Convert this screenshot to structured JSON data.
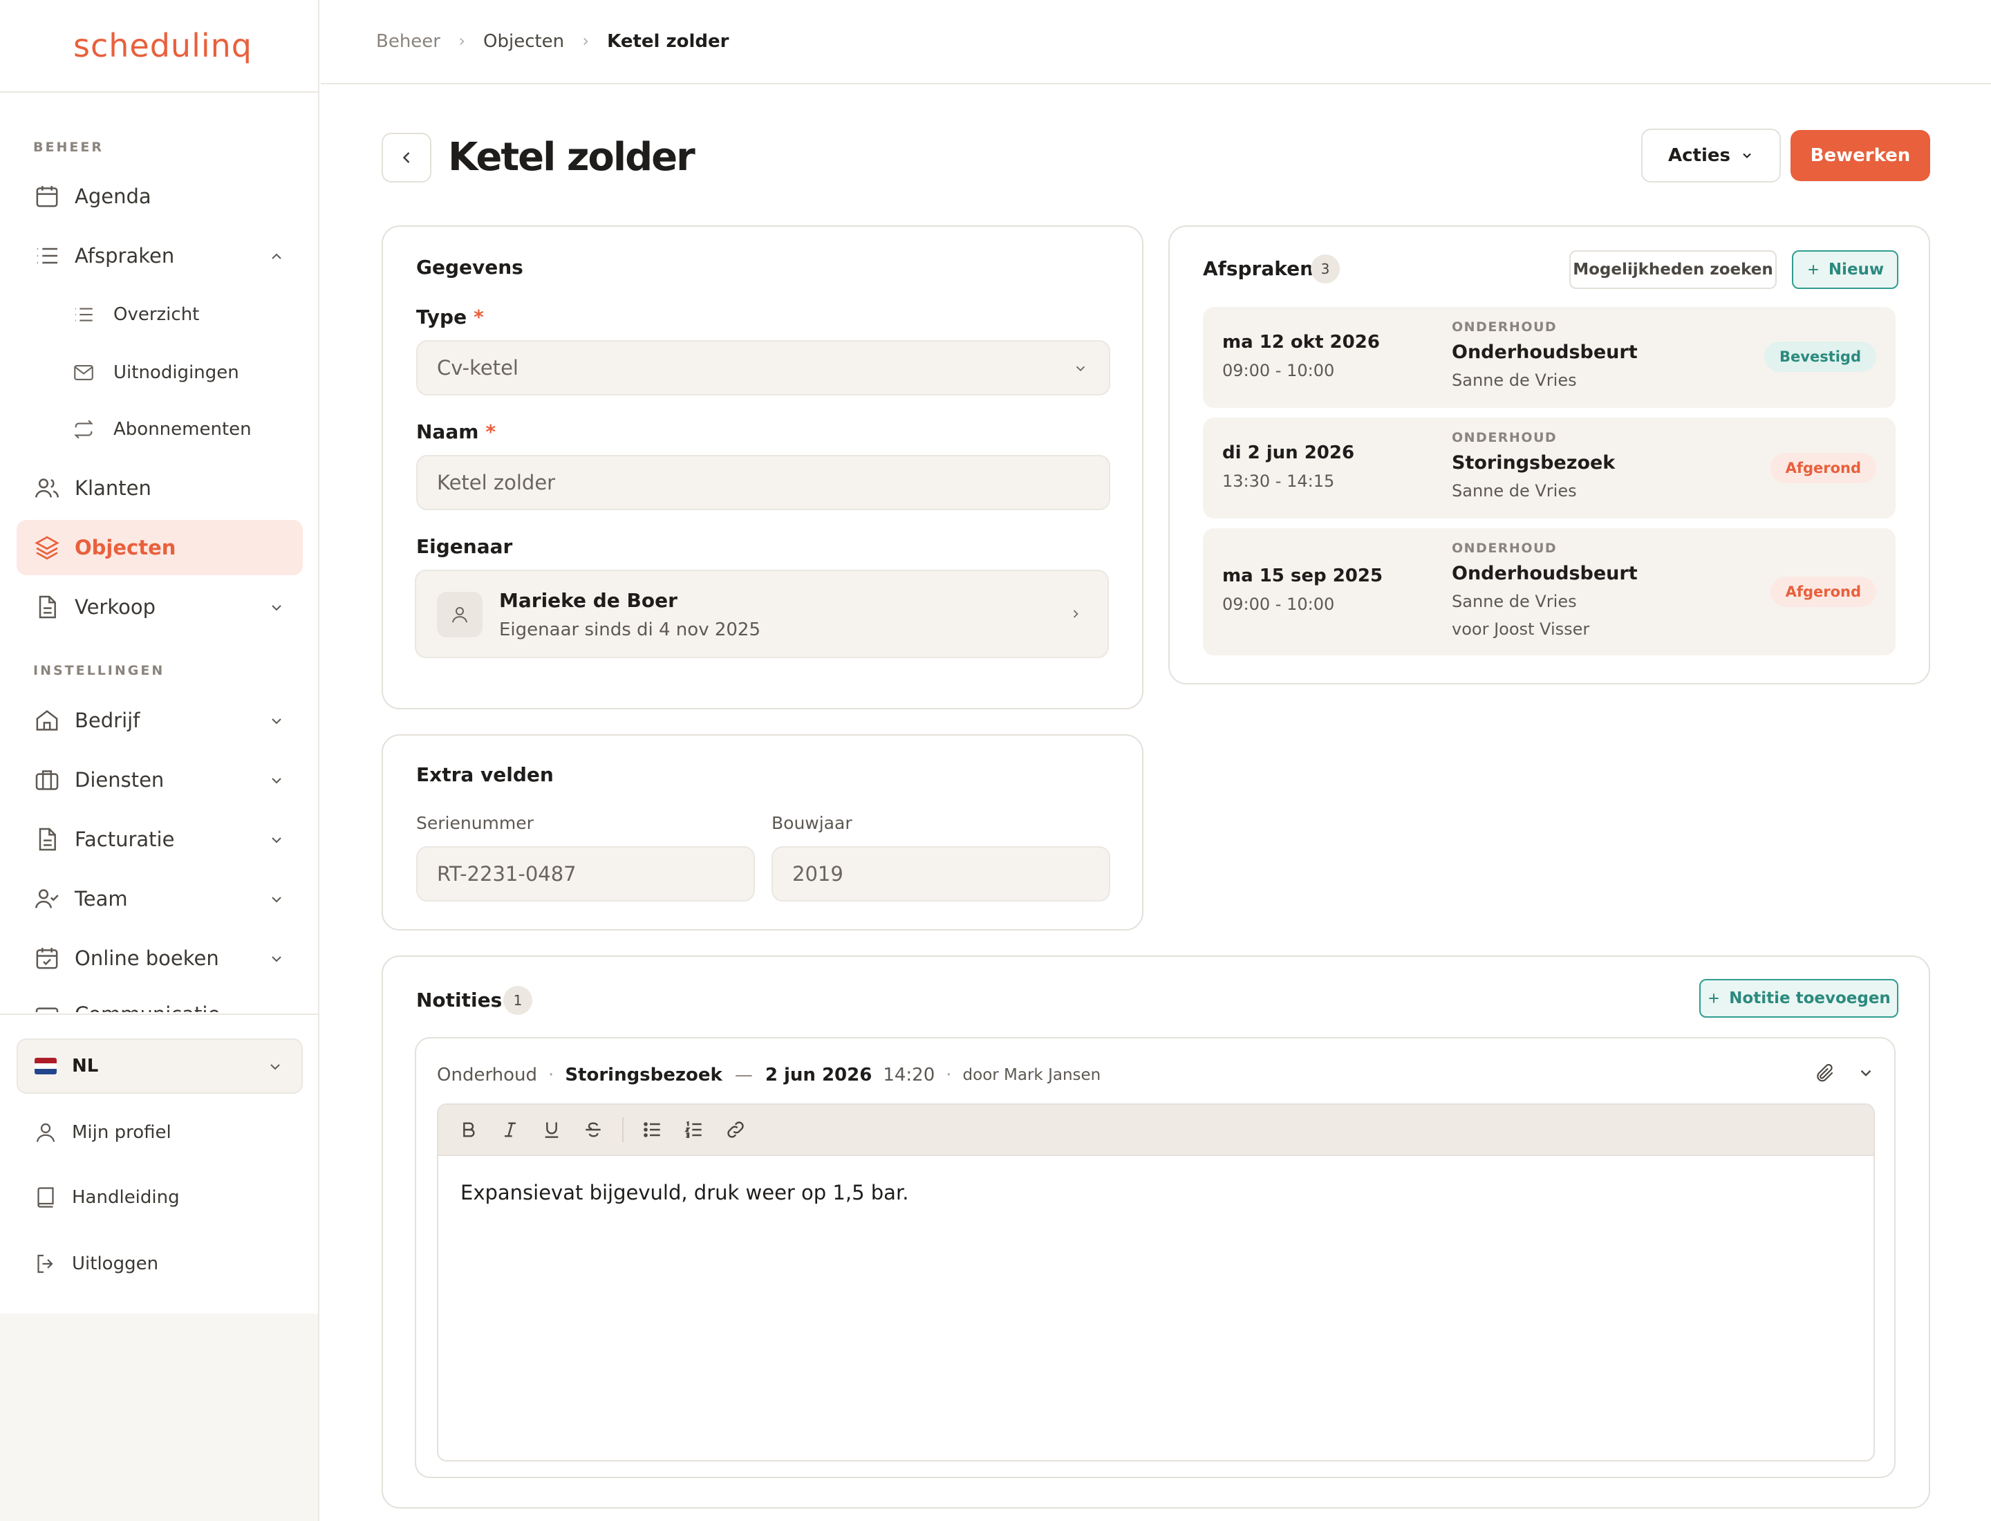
{
  "app": {
    "logo": "schedulinq"
  },
  "sidebar": {
    "section_beheer": "BEHEER",
    "section_instellingen": "INSTELLINGEN",
    "items": {
      "agenda": "Agenda",
      "afspraken": "Afspraken",
      "overzicht": "Overzicht",
      "uitnodigingen": "Uitnodigingen",
      "abonnementen": "Abonnementen",
      "klanten": "Klanten",
      "objecten": "Objecten",
      "verkoop": "Verkoop",
      "bedrijf": "Bedrijf",
      "diensten": "Diensten",
      "facturatie": "Facturatie",
      "team": "Team",
      "online_boeken": "Online boeken",
      "communicatie": "Communicatie"
    },
    "language": "NL",
    "bottom": {
      "profiel": "Mijn profiel",
      "handleiding": "Handleiding",
      "uitloggen": "Uitloggen"
    }
  },
  "breadcrumb": [
    "Beheer",
    "Objecten",
    "Ketel zolder"
  ],
  "header": {
    "title": "Ketel zolder",
    "acties": "Acties",
    "bewerken": "Bewerken"
  },
  "gegevens": {
    "title": "Gegevens",
    "type_label": "Type",
    "type_value": "Cv-ketel",
    "naam_label": "Naam",
    "naam_value": "Ketel zolder",
    "required_mark": "*",
    "eigenaar_label": "Eigenaar",
    "owner_name": "Marieke de Boer",
    "owner_since": "Eigenaar sinds di 4 nov 2025"
  },
  "extra": {
    "title": "Extra velden",
    "serienummer_label": "Serienummer",
    "serienummer_value": "RT-2231-0487",
    "bouwjaar_label": "Bouwjaar",
    "bouwjaar_value": "2019"
  },
  "afspraken": {
    "title": "Afspraken",
    "count": "3",
    "search_button": "Mogelijkheden zoeken",
    "new_button": "Nieuw",
    "items": [
      {
        "date": "ma 12 okt 2026",
        "time": "09:00 - 10:00",
        "category": "ONDERHOUD",
        "title": "Onderhoudsbeurt",
        "person": "Sanne de Vries",
        "status": "Bevestigd"
      },
      {
        "date": "di 2 jun 2026",
        "time": "13:30 - 14:15",
        "category": "ONDERHOUD",
        "title": "Storingsbezoek",
        "person": "Sanne de Vries",
        "status": "Afgerond"
      },
      {
        "date": "ma 15 sep 2025",
        "time": "09:00 - 10:00",
        "category": "ONDERHOUD",
        "title": "Onderhoudsbeurt",
        "person": "Sanne de Vries",
        "extra": "voor Joost Visser",
        "status": "Afgerond"
      }
    ]
  },
  "notities": {
    "title": "Notities",
    "count": "1",
    "add_button": "Notitie toevoegen",
    "note": {
      "category": "Onderhoud",
      "appointment": "Storingsbezoek",
      "dash": "—",
      "date": "2 jun 2026",
      "time": "14:20",
      "author": "door Mark Jansen",
      "separator": "·",
      "text": "Expansievat bijgevuld, druk weer op 1,5 bar."
    }
  },
  "colors": {
    "accent": "#e8603c",
    "teal": "#2b8a7e",
    "surface": "#f6f3ef",
    "border": "#e4e0da"
  }
}
